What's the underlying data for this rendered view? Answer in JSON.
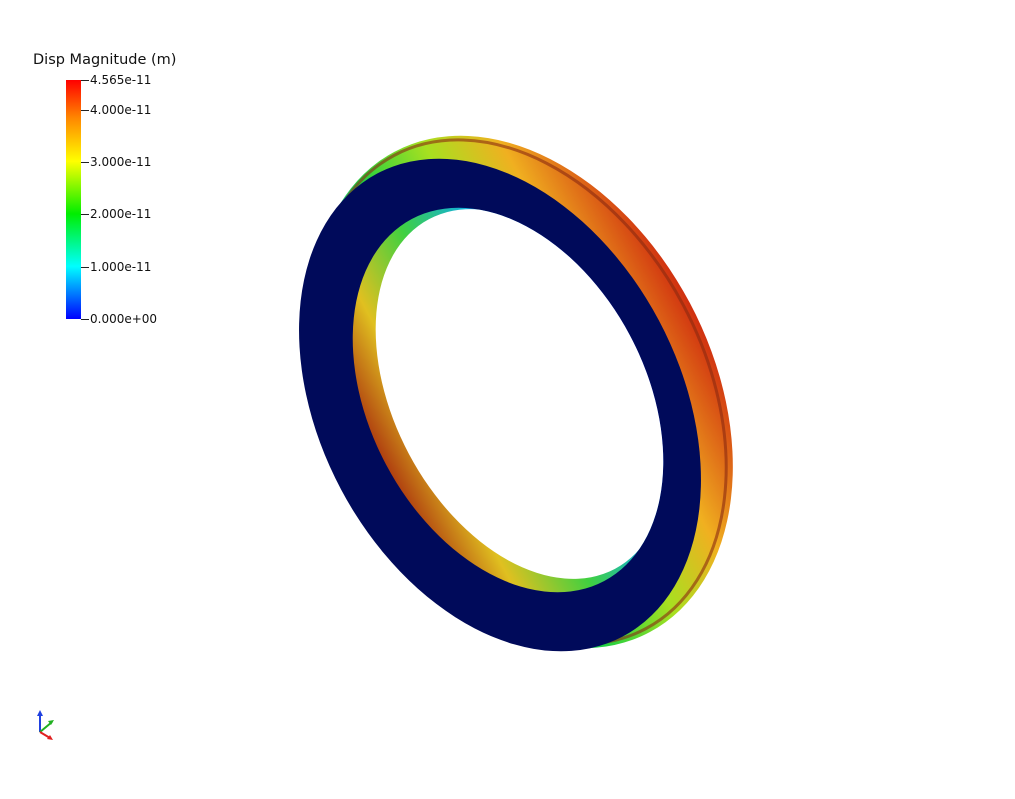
{
  "legend": {
    "title": "Disp Magnitude (m)",
    "colormap": "rainbow-blue-to-red",
    "range": [
      0,
      4.565e-11
    ],
    "ticks": [
      {
        "label": "4.565e-11",
        "value": 4.565e-11
      },
      {
        "label": "4.000e-11",
        "value": 4e-11
      },
      {
        "label": "3.000e-11",
        "value": 3e-11
      },
      {
        "label": "2.000e-11",
        "value": 2e-11
      },
      {
        "label": "1.000e-11",
        "value": 1e-11
      },
      {
        "label": "0.000e+00",
        "value": 0.0
      }
    ],
    "colors": {
      "min": "#0000ff",
      "low": "#00ffff",
      "mid": "#00ff00",
      "high": "#ffff00",
      "max": "#ff0000"
    }
  },
  "model": {
    "object": "ring",
    "face_color": "#000a5a"
  },
  "orientation_widget": {
    "icon": "axes-triad-icon",
    "x_color": "#e02020",
    "y_color": "#20b020",
    "z_color": "#2040e0"
  }
}
